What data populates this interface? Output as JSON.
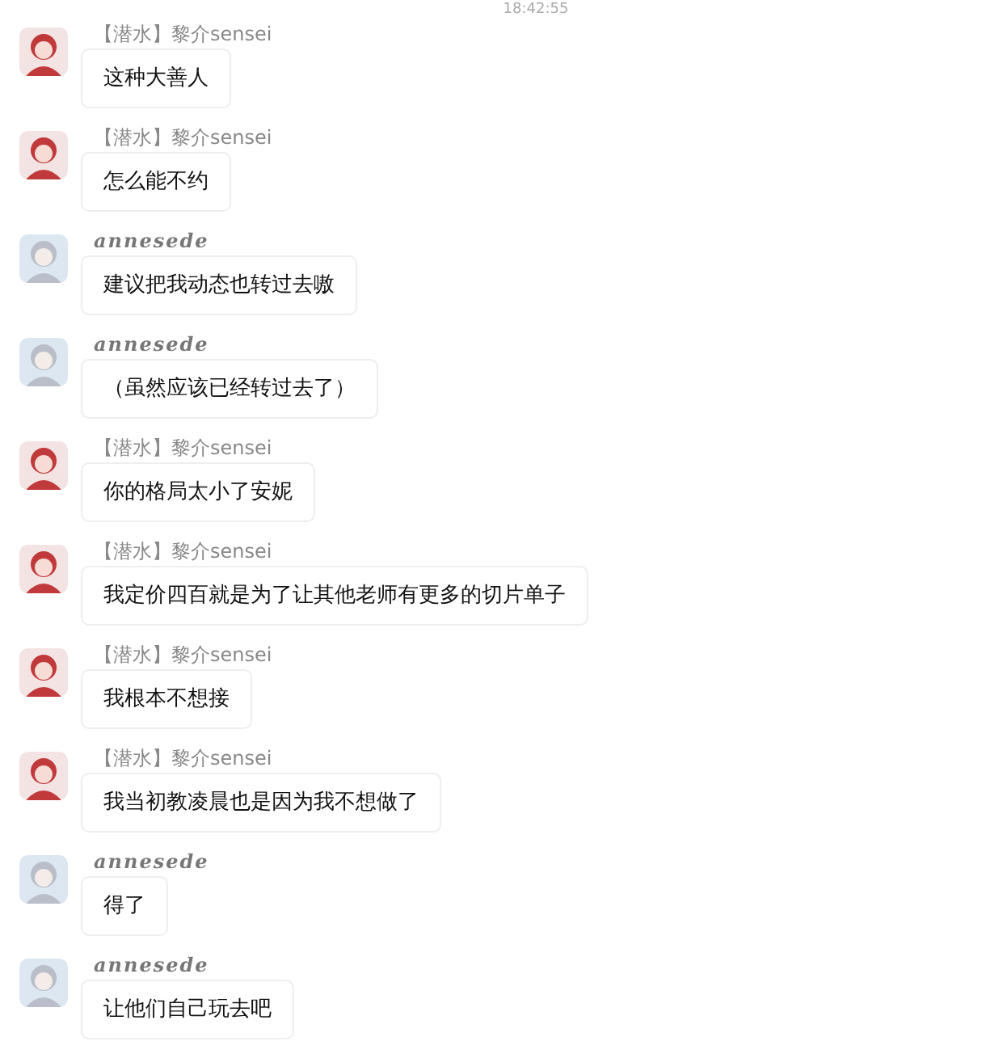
{
  "timestamp": "18:42:55",
  "messages": [
    {
      "sender": "【潜水】黎介sensei",
      "kind": "member",
      "text": "这种大善人"
    },
    {
      "sender": "【潜水】黎介sensei",
      "kind": "member",
      "text": "怎么能不约"
    },
    {
      "sender": "annesede",
      "kind": "styled",
      "text": "建议把我动态也转过去嗷"
    },
    {
      "sender": "annesede",
      "kind": "styled",
      "text": "（虽然应该已经转过去了）"
    },
    {
      "sender": "【潜水】黎介sensei",
      "kind": "member",
      "text": "你的格局太小了安妮"
    },
    {
      "sender": "【潜水】黎介sensei",
      "kind": "member",
      "text": "我定价四百就是为了让其他老师有更多的切片单子"
    },
    {
      "sender": "【潜水】黎介sensei",
      "kind": "member",
      "text": "我根本不想接"
    },
    {
      "sender": "【潜水】黎介sensei",
      "kind": "member",
      "text": "我当初教凌晨也是因为我不想做了"
    },
    {
      "sender": "annesede",
      "kind": "styled",
      "text": "得了"
    },
    {
      "sender": "annesede",
      "kind": "styled",
      "text": "让他们自己玩去吧"
    }
  ]
}
